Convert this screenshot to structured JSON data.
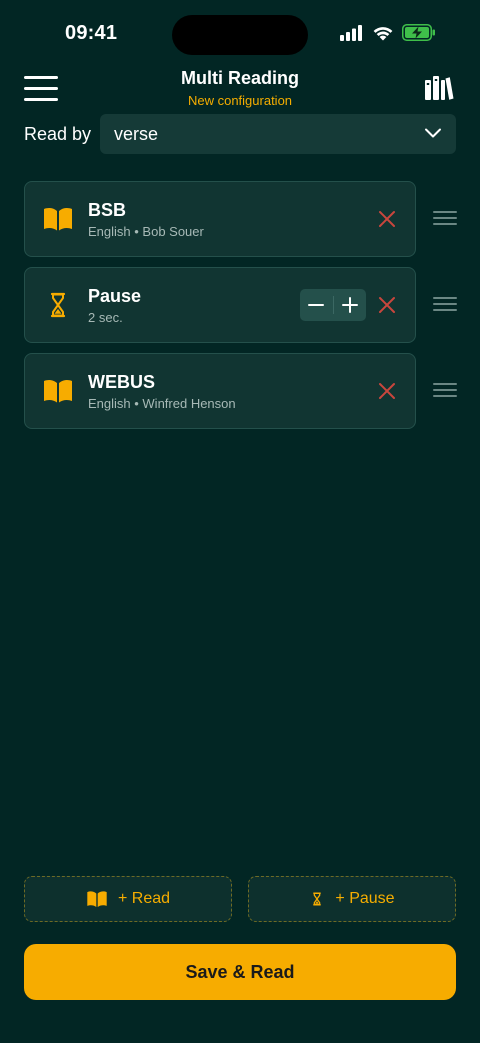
{
  "status_bar": {
    "time": "09:41"
  },
  "header": {
    "title": "Multi Reading",
    "subtitle": "New configuration",
    "menu_icon": "hamburger-menu-icon",
    "library_icon": "library-books-icon"
  },
  "read_by": {
    "label": "Read by",
    "value": "verse"
  },
  "items": [
    {
      "type": "reading",
      "icon": "open-book-icon",
      "title": "BSB",
      "subtitle": "English • Bob Souer"
    },
    {
      "type": "pause",
      "icon": "hourglass-icon",
      "title": "Pause",
      "subtitle": "2 sec.",
      "stepper": {
        "minus": "–",
        "plus": "+"
      }
    },
    {
      "type": "reading",
      "icon": "open-book-icon",
      "title": "WEBUS",
      "subtitle": "English • Winfred Henson"
    }
  ],
  "actions": {
    "add_read_label": "+ Read",
    "add_pause_label": "+ Pause",
    "save_label": "Save & Read"
  },
  "colors": {
    "background": "#022624",
    "card": "#113532",
    "accent": "#f7ac00",
    "remove": "#c9463d"
  }
}
